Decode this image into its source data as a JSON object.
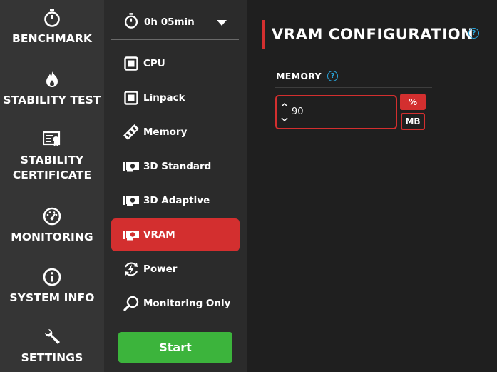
{
  "nav": {
    "benchmark": "BENCHMARK",
    "stability_test": "STABILITY TEST",
    "stability_certificate": "STABILITY\nCERTIFICATE",
    "monitoring": "MONITORING",
    "system_info": "SYSTEM INFO",
    "settings": "SETTINGS"
  },
  "timer": {
    "value": "0h 05min"
  },
  "tests": [
    {
      "label": "CPU",
      "icon": "cpu-chip-icon"
    },
    {
      "label": "Linpack",
      "icon": "cpu-chip-icon"
    },
    {
      "label": "Memory",
      "icon": "memory-stick-icon"
    },
    {
      "label": "3D Standard",
      "icon": "gpu-card-icon"
    },
    {
      "label": "3D Adaptive",
      "icon": "gpu-card-icon"
    },
    {
      "label": "VRAM",
      "icon": "gpu-card-icon",
      "active": true
    },
    {
      "label": "Power",
      "icon": "power-cycle-icon"
    },
    {
      "label": "Monitoring Only",
      "icon": "magnifier-icon"
    }
  ],
  "start_label": "Start",
  "main": {
    "title": "VRAM CONFIGURATION",
    "memory_label": "MEMORY",
    "memory_value": "90",
    "unit_percent": "%",
    "unit_mb": "MB"
  },
  "colors": {
    "accent": "#d32f2f",
    "start": "#3cb43c",
    "help": "#2aa7de",
    "nav_bg": "#353535",
    "sub_bg": "#2b2b2b",
    "main_bg": "#1f1f1f"
  }
}
